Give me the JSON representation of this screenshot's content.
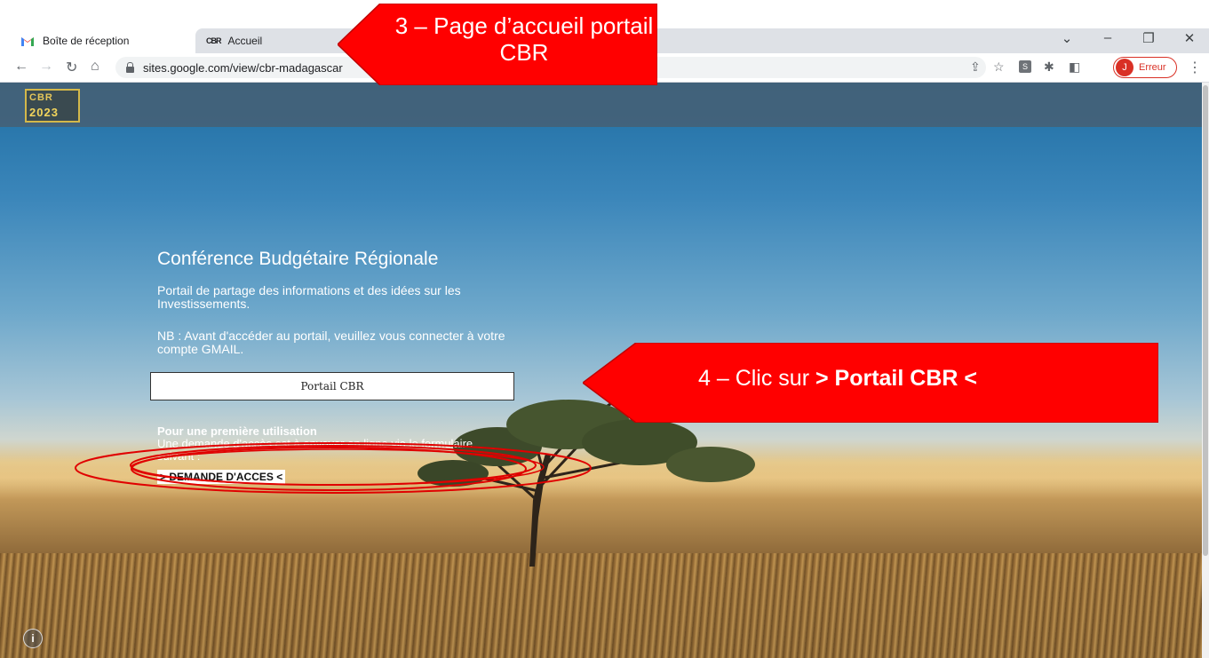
{
  "browser": {
    "tabs": [
      {
        "label": "Boîte de réception",
        "favicon": "gmail-icon"
      },
      {
        "label": "Accueil",
        "favicon": "CBR"
      }
    ],
    "url": "sites.google.com/view/cbr-madagascar",
    "profile_initial": "J",
    "profile_status": "Erreur",
    "extension_label": "S"
  },
  "site": {
    "logo_top": "CBR",
    "logo_bottom": "2023",
    "title": "Conférence Budgétaire Régionale",
    "description": "Portail de partage des informations et des idées sur les Investissements.",
    "nb_note": "NB : Avant d'accéder au portail, veuillez vous connecter à votre compte GMAIL.",
    "portal_button": "Portail CBR",
    "first_use_heading": "Pour une première utilisation",
    "first_use_text": "Une demande d'accès est à envoyer en ligne via le formulaire suivant :",
    "access_button": "> DEMANDE D'ACCES <"
  },
  "annotations": {
    "step3": "3 – Page d’accueil portail CBR",
    "step4_prefix": "4 – Clic sur ",
    "step4_bold": "> Portail CBR <"
  },
  "colors": {
    "callout": "#ff0000",
    "profile_accent": "#d93025",
    "logo_gold": "#d4b84a"
  }
}
